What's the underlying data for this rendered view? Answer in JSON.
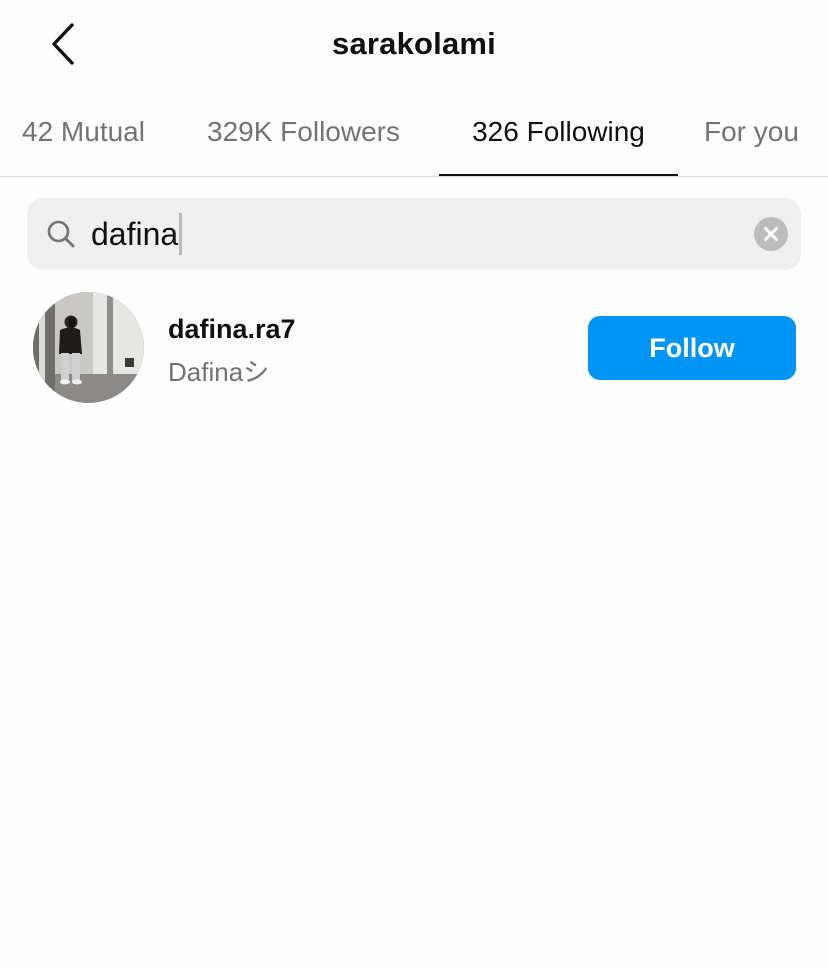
{
  "header": {
    "title": "sarakolami",
    "back_icon": "chevron-left-icon"
  },
  "tabs": [
    {
      "label": "42 Mutual",
      "active": false
    },
    {
      "label": "329K Followers",
      "active": false
    },
    {
      "label": "326 Following",
      "active": true
    },
    {
      "label": "For you",
      "active": false
    }
  ],
  "search": {
    "value": "dafina",
    "icon": "search-icon",
    "clear_icon": "clear-icon"
  },
  "results": [
    {
      "username": "dafina.ra7",
      "full_name": "Dafinaシ",
      "follow_label": "Follow"
    }
  ],
  "colors": {
    "accent": "#0095f6",
    "secondary_text": "#737373",
    "search_bg": "#efefef"
  }
}
